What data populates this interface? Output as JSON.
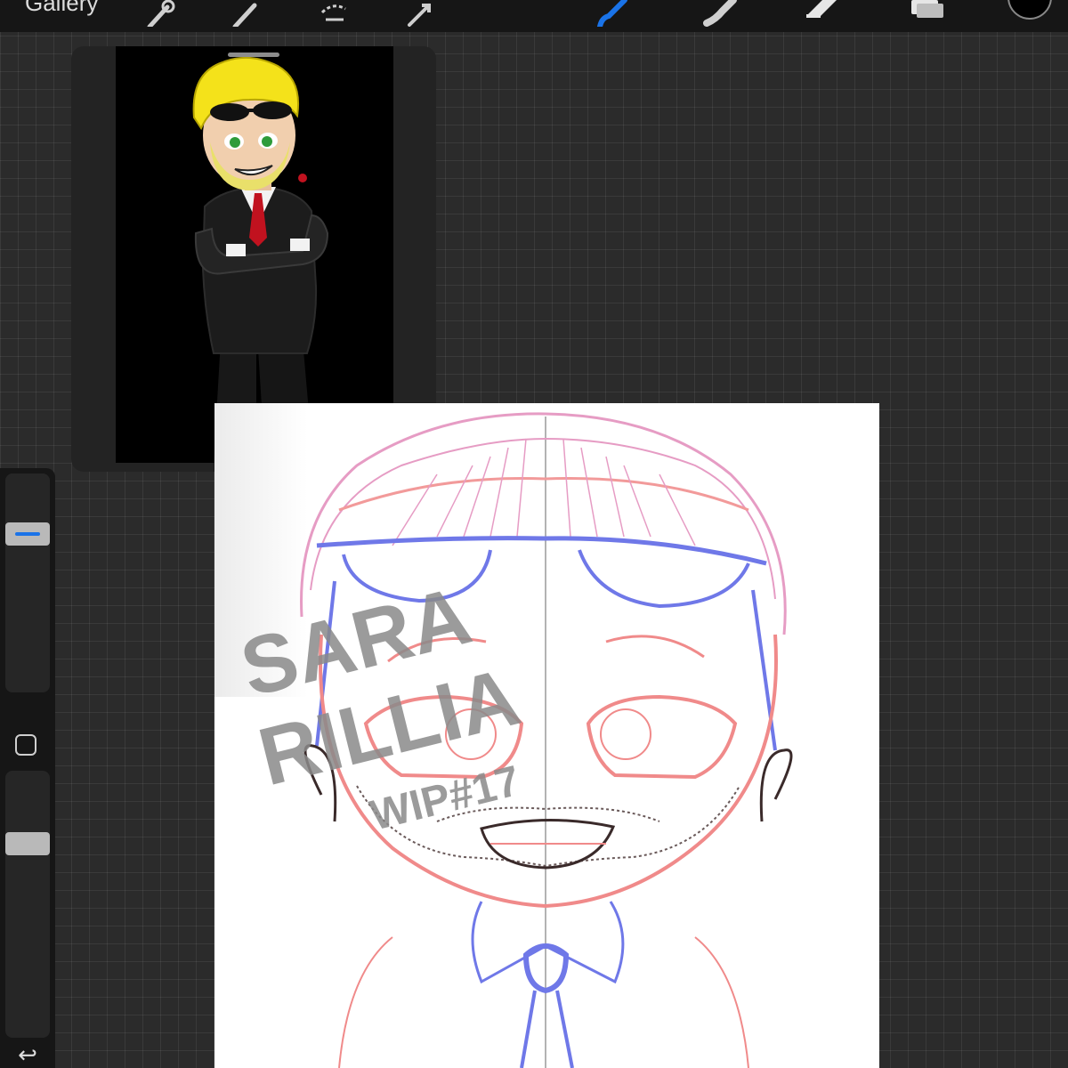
{
  "topbar": {
    "gallery_label": "Gallery",
    "tools": [
      {
        "name": "wrench-icon"
      },
      {
        "name": "magic-wand-icon"
      },
      {
        "name": "selection-icon"
      },
      {
        "name": "transform-icon"
      },
      {
        "name": "brush-icon",
        "active": true
      },
      {
        "name": "smudge-icon"
      },
      {
        "name": "eraser-icon"
      },
      {
        "name": "layers-icon"
      }
    ],
    "active_color": "#000000",
    "accent_color": "#1a73e8"
  },
  "sidebar": {
    "brush_size": 0.75,
    "brush_opacity": 0.75,
    "modify_icon": "square-icon",
    "undo_icon": "undo-icon",
    "undo_glyph": "↩"
  },
  "reference": {
    "background": "#000000"
  },
  "canvas": {
    "watermark": {
      "line1": "SARA",
      "line2": "RILLIA",
      "line3": "WIP#17"
    },
    "sketch_colors": {
      "hair": "#e69cc4",
      "accessories": "#6f78e8",
      "face": "#f08a8a",
      "ink": "#3a2a2a"
    }
  }
}
